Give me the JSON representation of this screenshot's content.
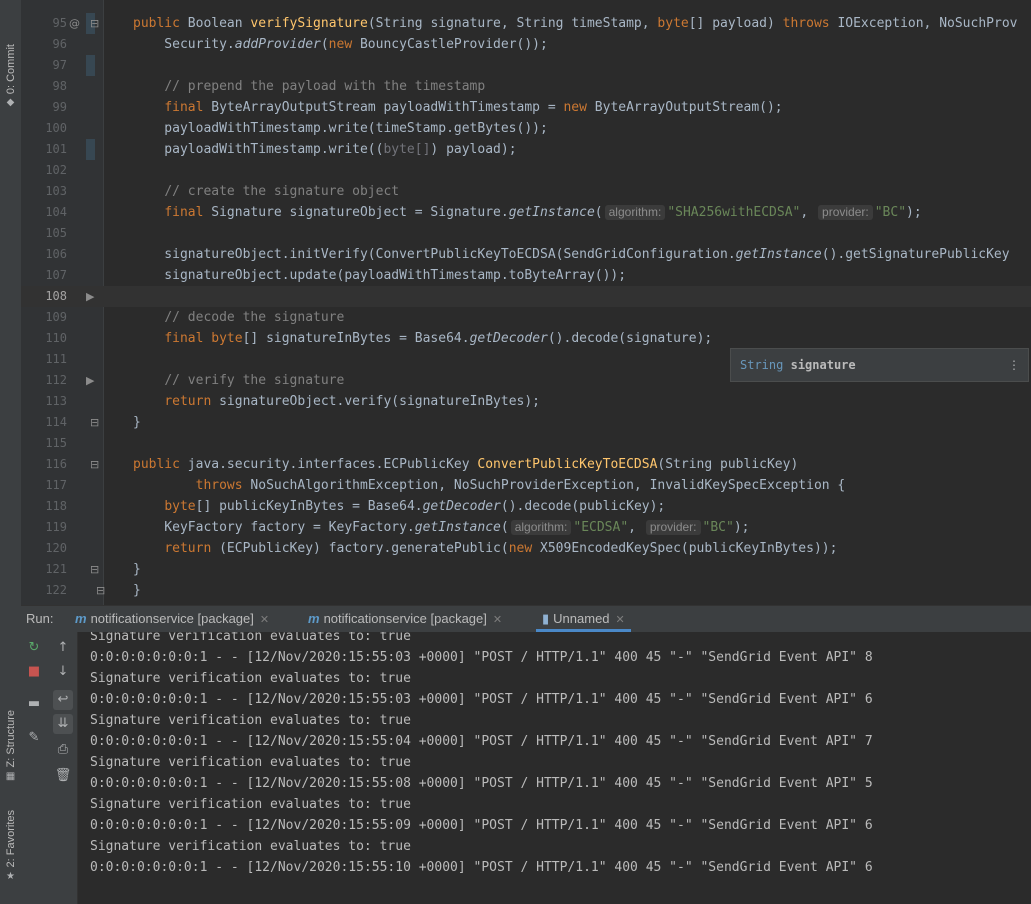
{
  "sidebar": {
    "tabs": [
      {
        "label": "0: Commit",
        "icon": "commit-icon"
      },
      {
        "label": "Z: Structure",
        "icon": "structure-icon"
      },
      {
        "label": "2: Favorites",
        "icon": "star-icon"
      }
    ]
  },
  "editor": {
    "lines": [
      {
        "n": "95",
        "html": "<span class=\"kw\">public </span>Boolean <span class=\"fn\">verifySignature</span>(String signature, String timeStamp, <span class=\"kw\">byte</span>[] payload) <span class=\"kw\">throws </span>IOException, NoSuchProv"
      },
      {
        "n": "96",
        "html": "    Security.<span class=\"it\">addProvider</span>(<span class=\"kw\">new </span>BouncyCastleProvider());"
      },
      {
        "n": "97",
        "html": ""
      },
      {
        "n": "98",
        "html": "    <span class=\"cm\">// prepend the payload with the timestamp</span>"
      },
      {
        "n": "99",
        "html": "    <span class=\"kw\">final </span>ByteArrayOutputStream payloadWithTimestamp = <span class=\"kw\">new </span>ByteArrayOutputStream();"
      },
      {
        "n": "100",
        "html": "    payloadWithTimestamp.write(timeStamp.getBytes());"
      },
      {
        "n": "101",
        "html": "    payloadWithTimestamp.write((<span class=\"gr\">byte[]</span>) payload);"
      },
      {
        "n": "102",
        "html": ""
      },
      {
        "n": "103",
        "html": "    <span class=\"cm\">// create the signature object</span>"
      },
      {
        "n": "104",
        "html": "    <span class=\"kw\">final </span>Signature signatureObject = Signature.<span class=\"it\">getInstance</span>(<span class=\"hint\">algorithm:</span><span class=\"str\">\"SHA256withECDSA\"</span>, <span class=\"hint\">provider:</span><span class=\"str\">\"BC\"</span>);"
      },
      {
        "n": "105",
        "html": ""
      },
      {
        "n": "106",
        "html": "    signatureObject.initVerify(ConvertPublicKeyToECDSA(SendGridConfiguration.<span class=\"it\">getInstance</span>().getSignaturePublicKey"
      },
      {
        "n": "107",
        "html": "    signatureObject.update(payloadWithTimestamp.toByteArray());"
      },
      {
        "n": "108",
        "html": ""
      },
      {
        "n": "109",
        "html": "    <span class=\"cm\">// decode the signature</span>"
      },
      {
        "n": "110",
        "html": "    <span class=\"kw\">final byte</span>[] signatureInBytes = Base64.<span class=\"it\">getDecoder</span>().decode(signature);"
      },
      {
        "n": "111",
        "html": ""
      },
      {
        "n": "112",
        "html": "    <span class=\"cm\">// verify the signature</span>"
      },
      {
        "n": "113",
        "html": "    <span class=\"kw\">return </span>signatureObject.verify(signatureInBytes);"
      },
      {
        "n": "114",
        "html": "}"
      },
      {
        "n": "115",
        "html": ""
      },
      {
        "n": "116",
        "html": "<span class=\"kw\">public </span>java.security.interfaces.ECPublicKey <span class=\"fn\">ConvertPublicKeyToECDSA</span>(String publicKey)"
      },
      {
        "n": "117",
        "html": "        <span class=\"kw\">throws </span>NoSuchAlgorithmException, NoSuchProviderException, InvalidKeySpecException {"
      },
      {
        "n": "118",
        "html": "    <span class=\"kw\">byte</span>[] publicKeyInBytes = Base64.<span class=\"it\">getDecoder</span>().decode(publicKey);"
      },
      {
        "n": "119",
        "html": "    KeyFactory factory = KeyFactory.<span class=\"it\">getInstance</span>(<span class=\"hint\">algorithm:</span><span class=\"str\">\"ECDSA\"</span>, <span class=\"hint\">provider:</span><span class=\"str\">\"BC\"</span>);"
      },
      {
        "n": "120",
        "html": "    <span class=\"kw\">return </span>(ECPublicKey) factory.generatePublic(<span class=\"kw\">new </span>X509EncodedKeySpec(publicKeyInBytes));"
      },
      {
        "n": "121",
        "html": "}"
      },
      {
        "n": "122",
        "html": "}"
      }
    ],
    "tooltip": {
      "type": "String",
      "name": "signature"
    }
  },
  "run": {
    "label": "Run:",
    "tabs": [
      {
        "label": "notificationservice [package]",
        "icon": "maven-icon",
        "active": false
      },
      {
        "label": "notificationservice [package]",
        "icon": "maven-icon",
        "active": false
      },
      {
        "label": "Unnamed",
        "icon": "run-config-icon",
        "active": true
      }
    ],
    "console": [
      "Signature verification evaluates to: true",
      "0:0:0:0:0:0:0:1 - - [12/Nov/2020:15:55:03 +0000] \"POST / HTTP/1.1\" 400 45 \"-\" \"SendGrid Event API\" 8",
      "Signature verification evaluates to: true",
      "0:0:0:0:0:0:0:1 - - [12/Nov/2020:15:55:03 +0000] \"POST / HTTP/1.1\" 400 45 \"-\" \"SendGrid Event API\" 6",
      "Signature verification evaluates to: true",
      "0:0:0:0:0:0:0:1 - - [12/Nov/2020:15:55:04 +0000] \"POST / HTTP/1.1\" 400 45 \"-\" \"SendGrid Event API\" 7",
      "Signature verification evaluates to: true",
      "0:0:0:0:0:0:0:1 - - [12/Nov/2020:15:55:08 +0000] \"POST / HTTP/1.1\" 400 45 \"-\" \"SendGrid Event API\" 5",
      "Signature verification evaluates to: true",
      "0:0:0:0:0:0:0:1 - - [12/Nov/2020:15:55:09 +0000] \"POST / HTTP/1.1\" 400 45 \"-\" \"SendGrid Event API\" 6",
      "Signature verification evaluates to: true",
      "0:0:0:0:0:0:0:1 - - [12/Nov/2020:15:55:10 +0000] \"POST / HTTP/1.1\" 400 45 \"-\" \"SendGrid Event API\" 6"
    ]
  }
}
